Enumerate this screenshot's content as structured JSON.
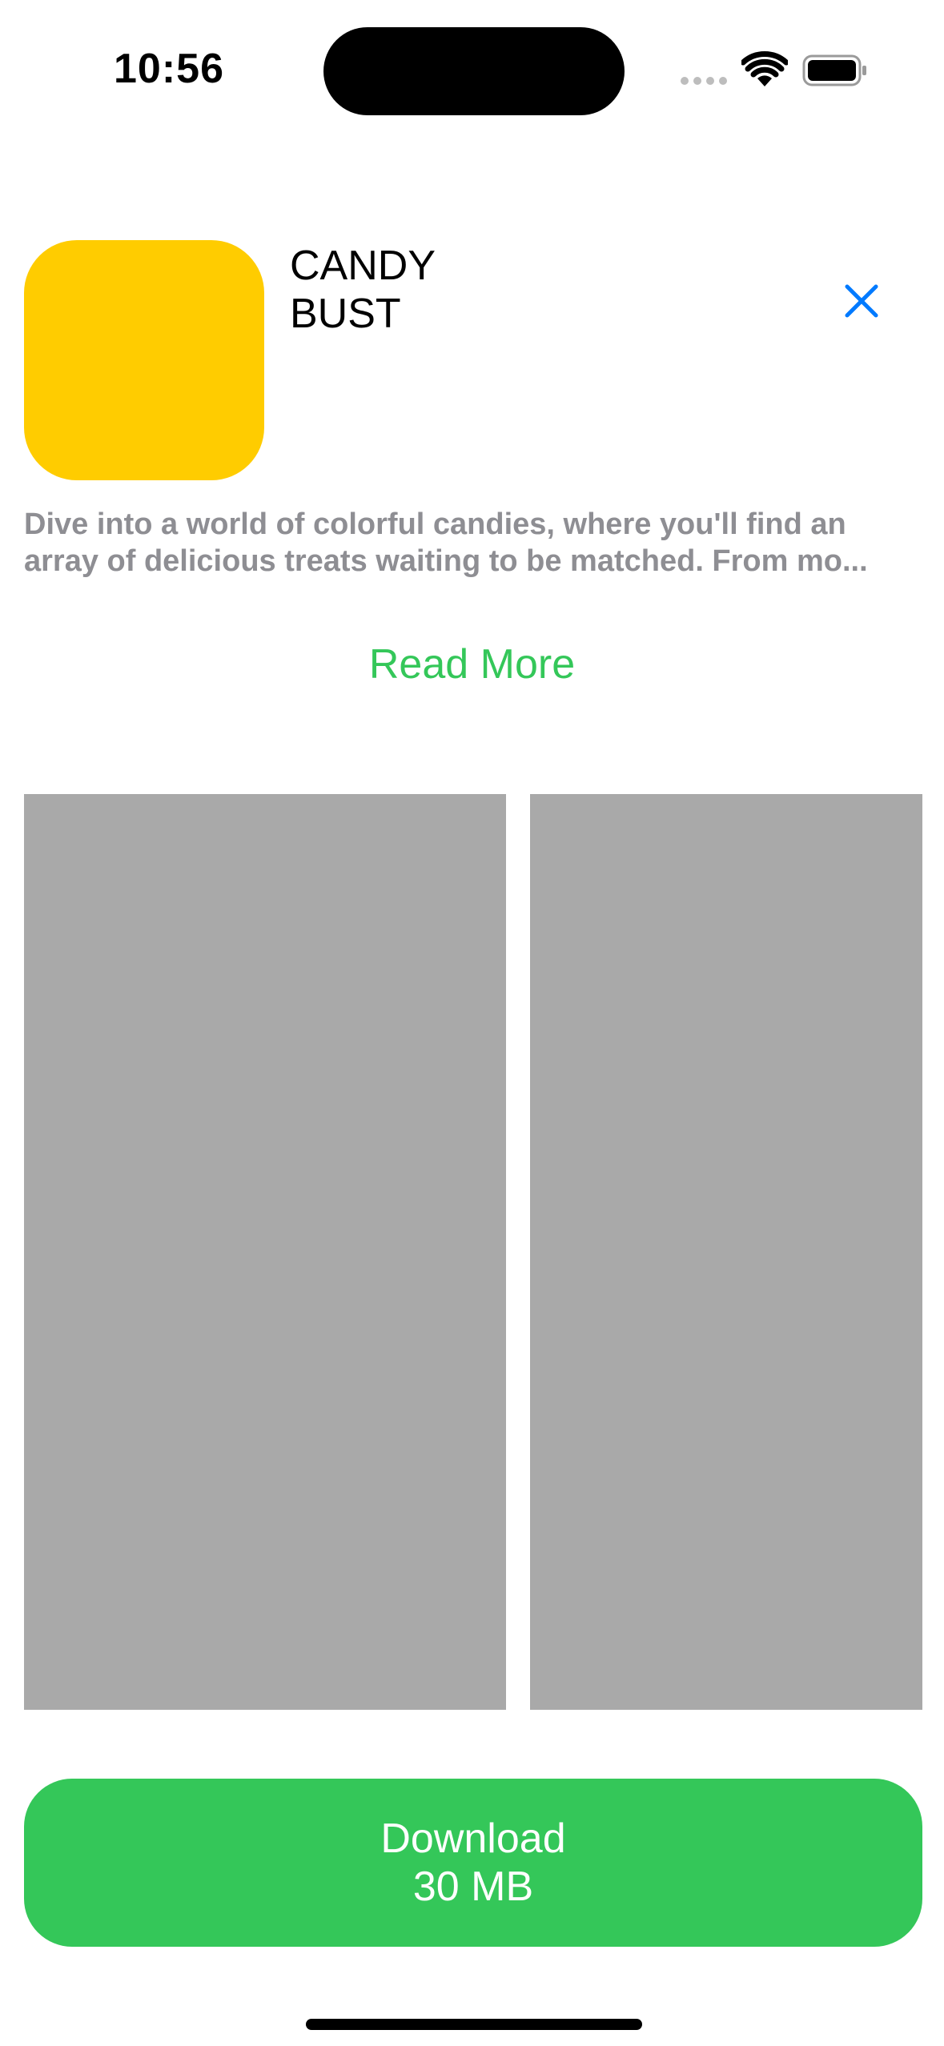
{
  "status_bar": {
    "time": "10:56"
  },
  "app": {
    "title": "CANDY\nBUST",
    "icon_color": "#FFCC00",
    "description": "Dive into a world of colorful candies, where you'll find an array of delicious treats waiting to be matched. From mo...",
    "read_more_label": "Read More",
    "download_label": "Download",
    "download_size": "30 MB"
  },
  "colors": {
    "accent_green": "#34C759",
    "close_blue": "#007AFF",
    "placeholder_gray": "#A9A9A9"
  },
  "icons": {
    "close": "close-icon",
    "wifi": "wifi-icon",
    "battery": "battery-icon"
  }
}
